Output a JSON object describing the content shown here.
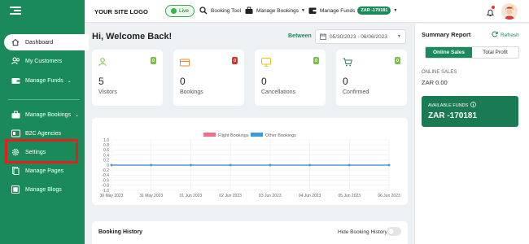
{
  "topbar": {
    "logo": "YOUR SITE LOGO",
    "live": "Live",
    "booking_tool": "Booking Tool",
    "manage_bookings": "Manage Bookings",
    "manage_funds": "Manage Funds",
    "funds_badge": "ZAR -170181"
  },
  "sidebar": {
    "items": [
      {
        "label": "Dashboard",
        "icon": "home-icon"
      },
      {
        "label": "My Customers",
        "icon": "users-icon"
      },
      {
        "label": "Manage Funds",
        "icon": "wallet-icon"
      },
      {
        "label": "Manage Bookings",
        "icon": "briefcase-icon"
      },
      {
        "label": "B2C Agencies",
        "icon": "b2c-icon"
      },
      {
        "label": "Settings",
        "icon": "gear-icon"
      },
      {
        "label": "Manage Pages",
        "icon": "pages-icon"
      },
      {
        "label": "Manage Blogs",
        "icon": "blog-icon"
      }
    ]
  },
  "main": {
    "welcome": "Hi, Welcome Back!",
    "between_label": "Between",
    "date_range": "05/30/2023 - 06/06/2023",
    "stats": [
      {
        "value": "5",
        "label": "Visitors",
        "badge": "0",
        "badge_color": "#7bc043",
        "icon": "person-icon",
        "icon_color": "#7bc043"
      },
      {
        "value": "0",
        "label": "Bookings",
        "badge": "0",
        "badge_color": "#d9302c",
        "icon": "card-icon",
        "icon_color": "#f08a2c"
      },
      {
        "value": "0",
        "label": "Cancellations",
        "badge": "0",
        "badge_color": "#7bc043",
        "icon": "monitor-icon",
        "icon_color": "#e8c21a"
      },
      {
        "value": "0",
        "label": "Confirmed",
        "badge": "0",
        "badge_color": "#7bc043",
        "icon": "cart-icon",
        "icon_color": "#2a7a5a"
      }
    ],
    "history_title": "Booking History",
    "hide_history": "Hide Booking History"
  },
  "chart_data": {
    "type": "line",
    "x": [
      "30 May 2023",
      "31 May 2023",
      "01 Jun 2023",
      "02 Jun 2023",
      "03 Jun 2023",
      "04 Jun 2023",
      "05 Jun 2023",
      "06 Jun 2023"
    ],
    "series": [
      {
        "name": "Flight Bookings",
        "values": [
          0,
          0,
          0,
          0,
          0,
          0,
          0,
          0
        ],
        "color": "#f0708a"
      },
      {
        "name": "Other Bookings",
        "values": [
          0,
          0,
          0,
          0,
          0,
          0,
          0,
          0
        ],
        "color": "#3b9be0"
      }
    ],
    "yticks": [
      "1.0",
      "0.8",
      "0.6",
      "0.4",
      "0.2",
      "0",
      "-0.2",
      "-0.4",
      "-0.6",
      "-0.8",
      "-1.0"
    ],
    "ylim": [
      -1.0,
      1.0
    ],
    "grid": true,
    "legend": "top-center"
  },
  "summary": {
    "title": "Summary Report",
    "refresh": "Refresh",
    "tab_online": "Online Sales",
    "tab_total": "Total Profit",
    "online_label": "ONLINE SALES",
    "online_value": "ZAR 0.00",
    "available_label": "AVAILABLE FUNDS",
    "available_value": "ZAR -170181"
  }
}
